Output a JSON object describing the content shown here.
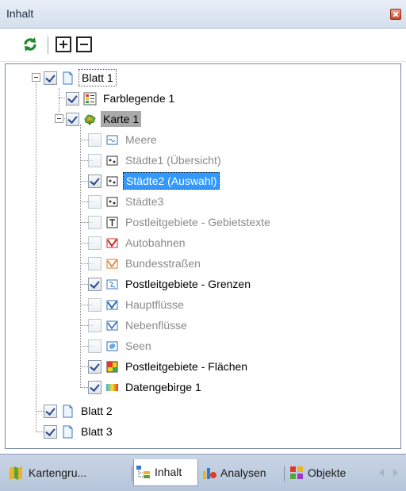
{
  "window": {
    "title": "Inhalt"
  },
  "toolbar": {
    "refresh_icon": "refresh-icon",
    "expand_icon": "expand-all-icon",
    "collapse_icon": "collapse-all-icon"
  },
  "tree": {
    "blatt1": "Blatt 1",
    "farblegende": "Farblegende 1",
    "karte1": "Karte 1",
    "layers": [
      {
        "label": "Meere",
        "checked": false,
        "dim": true
      },
      {
        "label": "Städte1 (Übersicht)",
        "checked": false,
        "dim": true
      },
      {
        "label": "Städte2 (Auswahl)",
        "checked": true,
        "dim": false
      },
      {
        "label": "Städte3",
        "checked": false,
        "dim": true
      },
      {
        "label": "Postleitgebiete - Gebietstexte",
        "checked": false,
        "dim": true
      },
      {
        "label": "Autobahnen",
        "checked": false,
        "dim": true
      },
      {
        "label": "Bundesstraßen",
        "checked": false,
        "dim": true
      },
      {
        "label": "Postleitgebiete - Grenzen",
        "checked": true,
        "dim": false
      },
      {
        "label": "Hauptflüsse",
        "checked": false,
        "dim": true
      },
      {
        "label": "Nebenflüsse",
        "checked": false,
        "dim": true
      },
      {
        "label": "Seen",
        "checked": false,
        "dim": true
      },
      {
        "label": "Postleitgebiete - Flächen",
        "checked": true,
        "dim": false
      },
      {
        "label": "Datengebirge 1",
        "checked": true,
        "dim": false
      }
    ],
    "blatt2": "Blatt 2",
    "blatt3": "Blatt 3"
  },
  "tabs": [
    {
      "label": "Kartengru...",
      "icon": "map-groups-icon",
      "active": false
    },
    {
      "label": "Inhalt",
      "icon": "content-tree-icon",
      "active": true
    },
    {
      "label": "Analysen",
      "icon": "analysis-icon",
      "active": false
    },
    {
      "label": "Objekte",
      "icon": "objects-icon",
      "active": false
    }
  ],
  "colors": {
    "selection": "#3399ff",
    "focus_gray": "#a9a9a9",
    "dim_text": "#8a8a8a",
    "tab_bar": "#c9d5e5"
  }
}
